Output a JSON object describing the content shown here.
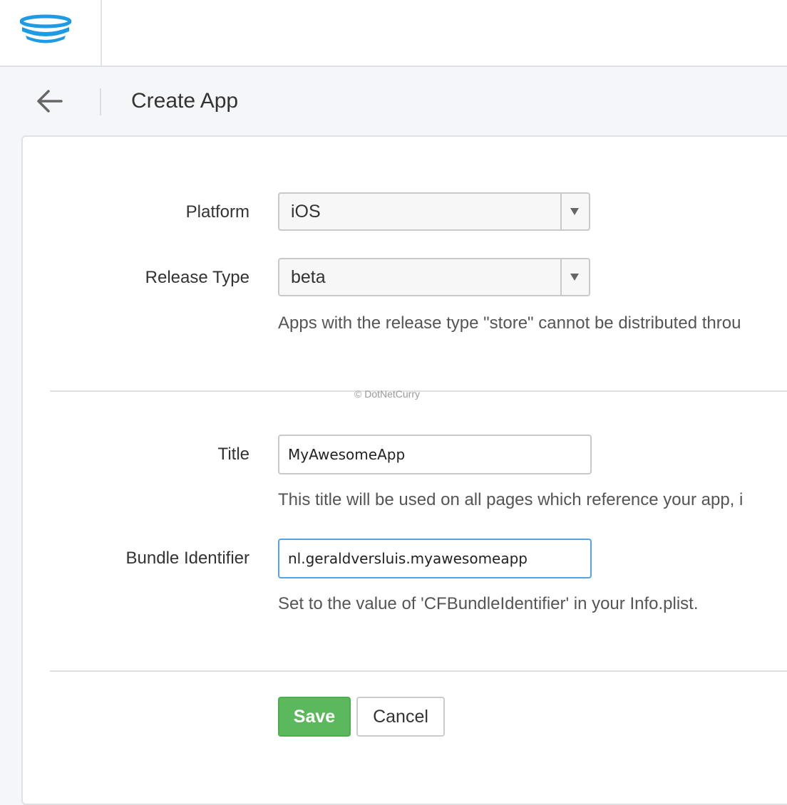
{
  "page": {
    "title": "Create App",
    "watermark": "© DotNetCurry"
  },
  "colors": {
    "accent": "#1e9be6",
    "save": "#5cb85c",
    "focus": "#55a3e0"
  },
  "icons": {
    "logo": "stack-logo-icon",
    "back": "arrow-left-icon",
    "dropdown": "caret-down-icon"
  },
  "form": {
    "platform": {
      "label": "Platform",
      "value": "iOS"
    },
    "release_type": {
      "label": "Release Type",
      "value": "beta",
      "help": "Apps with the release type \"store\" cannot be distributed throu"
    },
    "title": {
      "label": "Title",
      "value": "MyAwesomeApp",
      "help": "This title will be used on all pages which reference your app, i"
    },
    "bundle_identifier": {
      "label": "Bundle Identifier",
      "value": "nl.geraldversluis.myawesomeapp",
      "help": "Set to the value of 'CFBundleIdentifier' in your Info.plist."
    }
  },
  "actions": {
    "save": "Save",
    "cancel": "Cancel"
  }
}
